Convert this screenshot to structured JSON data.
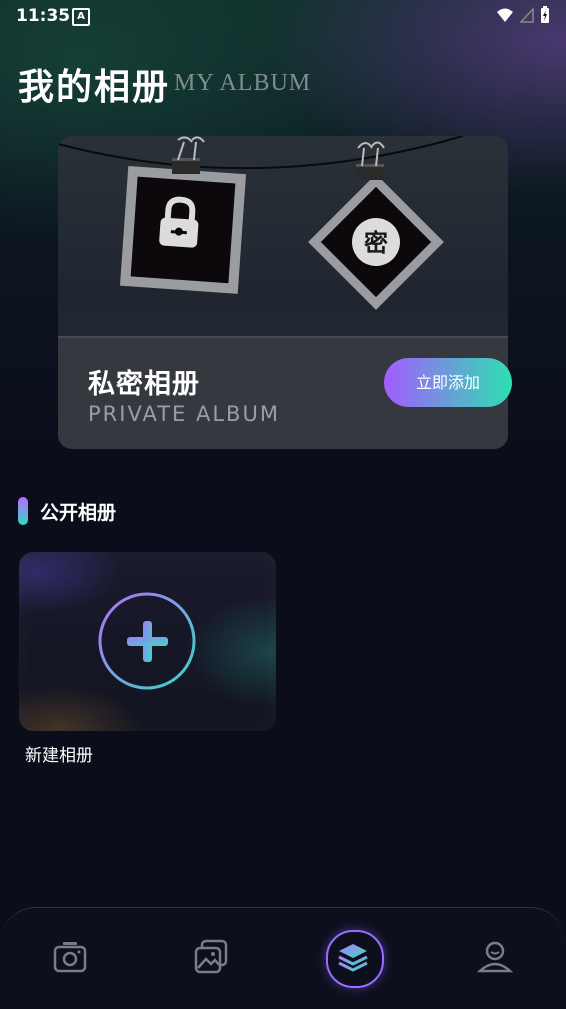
{
  "status_bar": {
    "time": "11:35",
    "badge": "A"
  },
  "header": {
    "title": "我的相册",
    "subtitle": "MY ALBUM"
  },
  "private_album": {
    "name": "私密相册",
    "subtitle": "PRIVATE ALBUM",
    "add_button": "立即添加",
    "icon_char": "密"
  },
  "public_section": {
    "title": "公开相册"
  },
  "new_album": {
    "label": "新建相册"
  },
  "bottom_nav": {
    "items": [
      {
        "icon": "camera-icon"
      },
      {
        "icon": "gallery-icon"
      },
      {
        "icon": "albums-icon",
        "active": true
      },
      {
        "icon": "profile-icon"
      }
    ]
  },
  "colors": {
    "accent_purple": "#a45cff",
    "accent_teal": "#2ee0b0",
    "background": "#0b0e1a"
  }
}
